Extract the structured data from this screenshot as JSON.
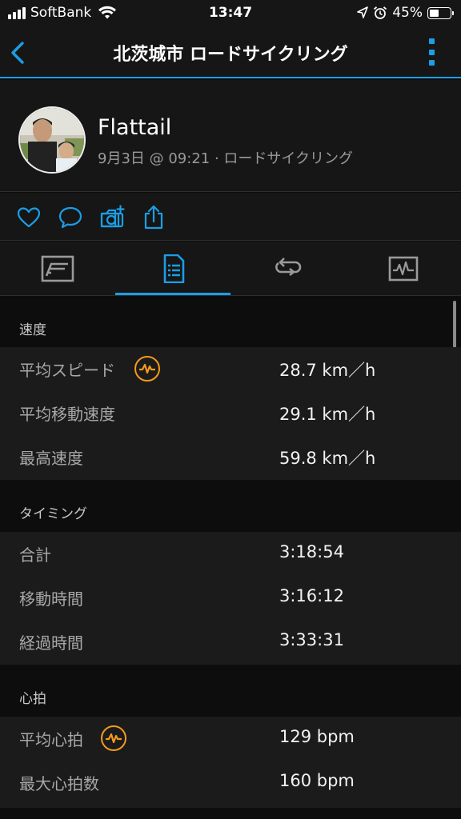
{
  "status_bar": {
    "carrier": "SoftBank",
    "time": "13:47",
    "battery_percent": "45%",
    "battery_level": 0.45,
    "icons": [
      "signal-icon",
      "wifi-icon",
      "location-arrow-icon",
      "alarm-icon",
      "battery-icon"
    ]
  },
  "nav": {
    "title": "北茨城市 ロードサイクリング",
    "back_icon": "chevron-left-icon",
    "more_icon": "more-vertical-icon",
    "accent": "#1b9ee6"
  },
  "profile": {
    "name": "Flattail",
    "meta": "9月3日 @ 09:21 · ロードサイクリング"
  },
  "actions": [
    "heart-icon",
    "comment-icon",
    "camera-add-icon",
    "share-icon"
  ],
  "tabs": [
    {
      "icon": "overview-icon",
      "active": false
    },
    {
      "icon": "stats-list-icon",
      "active": true
    },
    {
      "icon": "laps-icon",
      "active": false
    },
    {
      "icon": "chart-icon",
      "active": false
    }
  ],
  "sections": {
    "speed": {
      "header": "速度",
      "rows": [
        {
          "label": "平均スピード",
          "value": "28.7 km／h",
          "badge": true
        },
        {
          "label": "平均移動速度",
          "value": "29.1 km／h"
        },
        {
          "label": "最高速度",
          "value": "59.8 km／h"
        }
      ]
    },
    "timing": {
      "header": "タイミング",
      "rows": [
        {
          "label": "合計",
          "value": "3:18:54"
        },
        {
          "label": "移動時間",
          "value": "3:16:12"
        },
        {
          "label": "経過時間",
          "value": "3:33:31"
        }
      ]
    },
    "heart_rate": {
      "header": "心拍",
      "rows": [
        {
          "label": "平均心拍",
          "value": "129 bpm",
          "badge": true
        },
        {
          "label": "最大心拍数",
          "value": "160 bpm"
        }
      ]
    }
  },
  "colors": {
    "accent": "#1b9ee6",
    "badge": "#f39a1c",
    "row_background": "#1b1b1b",
    "page_background": "#0d0d0d"
  }
}
